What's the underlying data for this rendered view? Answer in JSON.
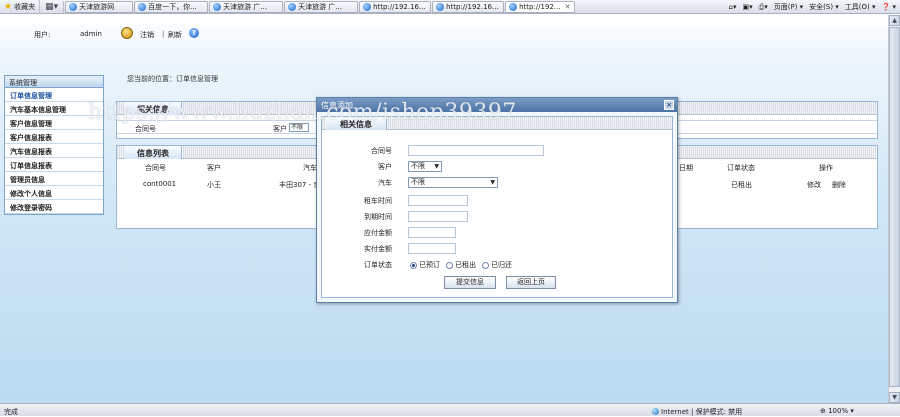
{
  "browser": {
    "favorites": "收藏夹",
    "tabs": [
      {
        "label": "天津旅游网"
      },
      {
        "label": "百度一下，你..."
      },
      {
        "label": "天津旅游 广..."
      },
      {
        "label": "天津旅游 广..."
      },
      {
        "label": "http://192.16..."
      },
      {
        "label": "http://192.16..."
      },
      {
        "label": "http://192..."
      }
    ],
    "tools": {
      "page": "页面(P) ▾",
      "safety": "安全(S) ▾",
      "tools_menu": "工具(O) ▾",
      "help": "❓ ▾"
    },
    "status": {
      "done": "完成",
      "zone": "Internet | 保护模式: 禁用",
      "zoom": "100% ▾"
    }
  },
  "user_bar": {
    "user_label": "用户:",
    "user_name": "admin",
    "logout": "注销",
    "sep": "|",
    "refresh": "刷新"
  },
  "sidebar": {
    "header": "系统管理",
    "items": [
      {
        "label": "订单信息管理"
      },
      {
        "label": "汽车基本信息管理"
      },
      {
        "label": "客户信息管理"
      },
      {
        "label": "客户信息报表"
      },
      {
        "label": "汽车信息报表"
      },
      {
        "label": "订单信息报表"
      },
      {
        "label": "管理员信息"
      },
      {
        "label": "修改个人信息"
      },
      {
        "label": "修改登录密码"
      }
    ]
  },
  "breadcrumb": "您当前的位置：订单信息管理",
  "related_panel": {
    "title": "相关信息",
    "fields": {
      "contract": "合同号",
      "customer": "客户",
      "customer_value": "不限"
    }
  },
  "list_panel": {
    "title": "信息列表",
    "columns": [
      "合同号",
      "客户",
      "汽车",
      "日期",
      "订单状态",
      "操作"
    ],
    "rows": [
      {
        "contract": "cont0001",
        "customer": "小王",
        "car": "丰田307 - 京...",
        "status": "已租出",
        "edit": "修改",
        "delete": "删除"
      }
    ]
  },
  "watermark": "https://www.huzhan.com/ishop39397",
  "dialog": {
    "title": "信息添加",
    "close": "×",
    "section": "相关信息",
    "fields": [
      {
        "label": "合同号",
        "value": ""
      },
      {
        "label": "客户",
        "value": "不限"
      },
      {
        "label": "汽车",
        "value": "不限"
      },
      {
        "label": "租车时间",
        "value": ""
      },
      {
        "label": "到期时间",
        "value": ""
      },
      {
        "label": "应付金额",
        "value": ""
      },
      {
        "label": "实付金额",
        "value": ""
      },
      {
        "label": "订单状态",
        "value": ""
      }
    ],
    "status_options": [
      {
        "label": "已预订",
        "checked": true
      },
      {
        "label": "已租出",
        "checked": false
      },
      {
        "label": "已归还",
        "checked": false
      }
    ],
    "submit": "提交信息",
    "back": "返回上页"
  }
}
